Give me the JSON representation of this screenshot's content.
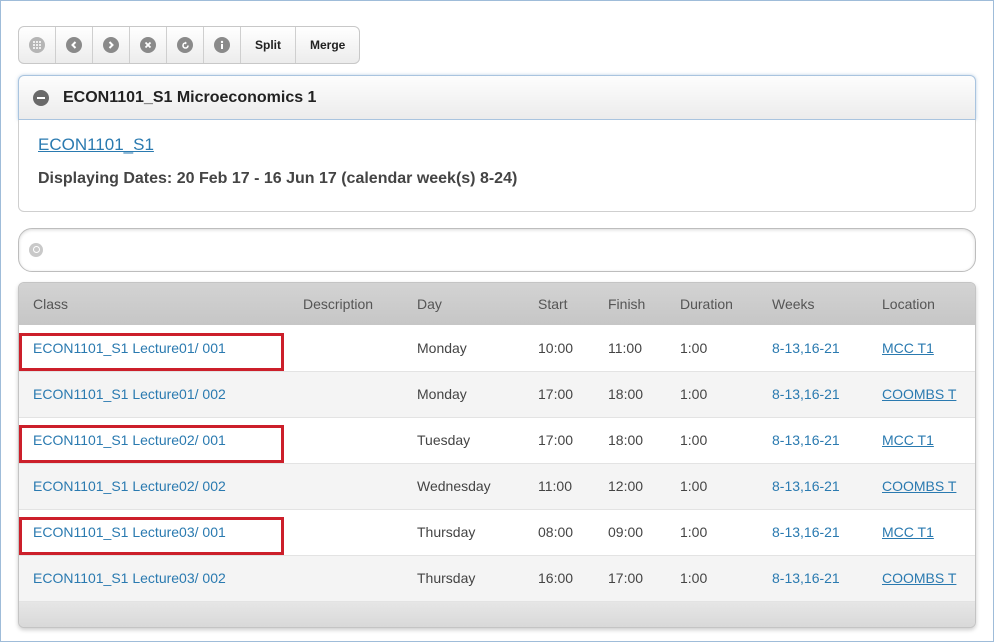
{
  "toolbar": {
    "icons": [
      "grid-icon",
      "back-icon",
      "forward-icon",
      "close-icon",
      "refresh-icon",
      "info-icon"
    ],
    "split_label": "Split",
    "merge_label": "Merge"
  },
  "panel": {
    "title": "ECON1101_S1 Microeconomics 1",
    "course_link": "ECON1101_S1",
    "dates_text": "Displaying Dates: 20 Feb 17 - 16 Jun 17 (calendar week(s) 8-24)"
  },
  "search": {
    "placeholder": "",
    "value": ""
  },
  "table": {
    "headers": [
      "Class",
      "Description",
      "Day",
      "Start",
      "Finish",
      "Duration",
      "Weeks",
      "Location"
    ],
    "rows": [
      {
        "class": "ECON1101_S1 Lecture01/ 001",
        "description": "",
        "day": "Monday",
        "start": "10:00",
        "finish": "11:00",
        "duration": "1:00",
        "weeks": "8-13,16-21",
        "location": "MCC T1",
        "highlighted": true
      },
      {
        "class": "ECON1101_S1 Lecture01/ 002",
        "description": "",
        "day": "Monday",
        "start": "17:00",
        "finish": "18:00",
        "duration": "1:00",
        "weeks": "8-13,16-21",
        "location": "COOMBS T",
        "highlighted": false
      },
      {
        "class": "ECON1101_S1 Lecture02/ 001",
        "description": "",
        "day": "Tuesday",
        "start": "17:00",
        "finish": "18:00",
        "duration": "1:00",
        "weeks": "8-13,16-21",
        "location": "MCC T1",
        "highlighted": true
      },
      {
        "class": "ECON1101_S1 Lecture02/ 002",
        "description": "",
        "day": "Wednesday",
        "start": "11:00",
        "finish": "12:00",
        "duration": "1:00",
        "weeks": "8-13,16-21",
        "location": "COOMBS T",
        "highlighted": false
      },
      {
        "class": "ECON1101_S1 Lecture03/ 001",
        "description": "",
        "day": "Thursday",
        "start": "08:00",
        "finish": "09:00",
        "duration": "1:00",
        "weeks": "8-13,16-21",
        "location": "MCC T1",
        "highlighted": true
      },
      {
        "class": "ECON1101_S1 Lecture03/ 002",
        "description": "",
        "day": "Thursday",
        "start": "16:00",
        "finish": "17:00",
        "duration": "1:00",
        "weeks": "8-13,16-21",
        "location": "COOMBS T",
        "highlighted": false
      }
    ]
  },
  "colors": {
    "link": "#2a7ab0",
    "highlight": "#cc1f2a"
  }
}
